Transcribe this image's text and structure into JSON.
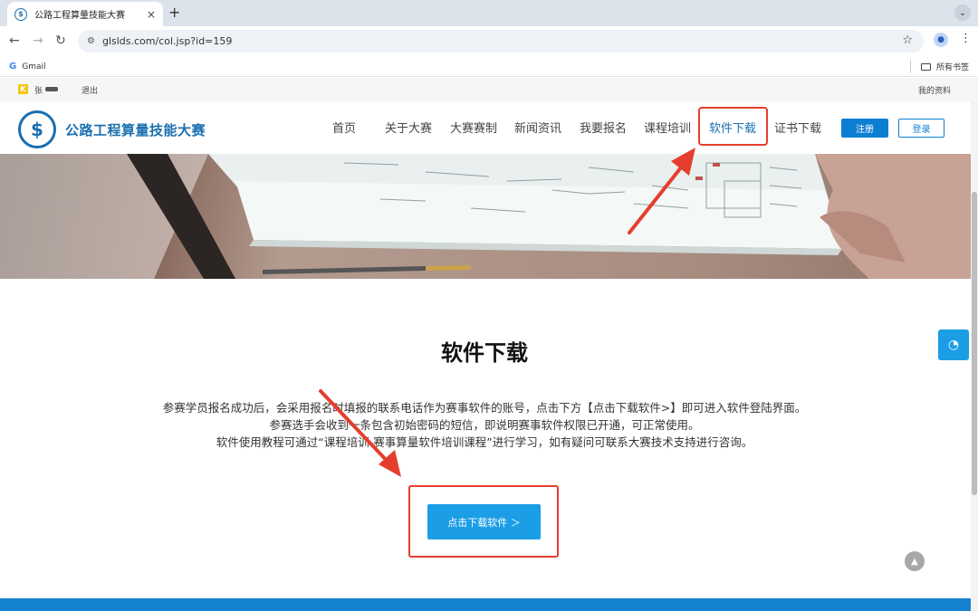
{
  "browser": {
    "tab_title": "公路工程算量技能大赛",
    "tab_close": "×",
    "new_tab": "+",
    "url": "glslds.com/col.jsp?id=159",
    "bookmark_gmail": "Gmail",
    "bookmark_all": "所有书签"
  },
  "userbar": {
    "user_name": "张",
    "logout": "退出",
    "my_info": "我的资料"
  },
  "header": {
    "brand": "公路工程算量技能大赛",
    "nav": [
      "首页",
      "关于大赛",
      "大赛赛制",
      "新闻资讯",
      "我要报名",
      "课程培训",
      "软件下载",
      "证书下载"
    ],
    "active_nav": "软件下载",
    "register": "注册",
    "login": "登录"
  },
  "main": {
    "title": "软件下载",
    "lines": [
      "参赛学员报名成功后，会采用报名时填报的联系电话作为赛事软件的账号，点击下方【点击下载软件>】即可进入软件登陆界面。",
      "参赛选手会收到一条包含初始密码的短信，即说明赛事软件权限已开通，可正常使用。",
      "软件使用教程可通过“课程培训-赛事算量软件培训课程”进行学习，如有疑问可联系大赛技术支持进行咨询。"
    ],
    "download_button": "点击下载软件 ＞"
  },
  "colors": {
    "brand_blue": "#1a6fb0",
    "button_blue": "#1b9ee6",
    "annotation_red": "#e53e2e"
  }
}
